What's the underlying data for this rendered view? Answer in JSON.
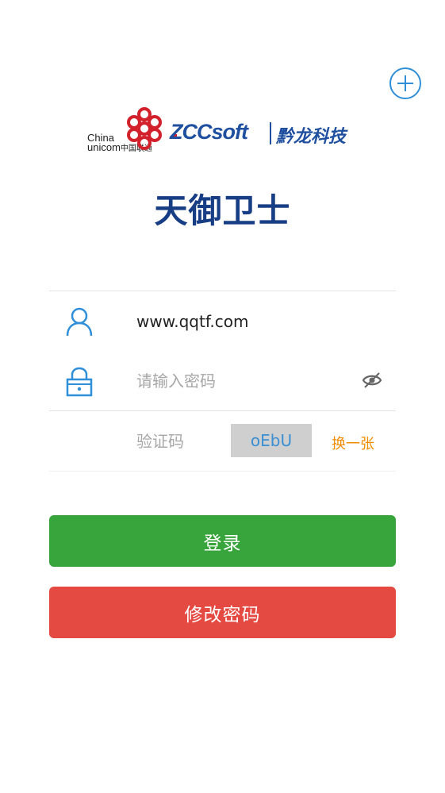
{
  "header": {
    "add_button_icon": "plus-circle-icon",
    "logo": {
      "china": "China",
      "unicom": "unicom",
      "unicom_cn": "中国联通",
      "zccsoft": "ZCCsoft",
      "partner_cn": "黔龙科技"
    },
    "app_title": "天御卫士"
  },
  "form": {
    "username": {
      "icon": "user-icon",
      "value": "www.qqtf.com"
    },
    "password": {
      "icon": "lock-icon",
      "placeholder": "请输入密码",
      "toggle_icon": "eye-off-icon"
    },
    "captcha": {
      "placeholder": "验证码",
      "code": "oEbU",
      "refresh_label": "换一张"
    }
  },
  "actions": {
    "login_label": "登录",
    "change_password_label": "修改密码"
  },
  "colors": {
    "accent_blue": "#2f8fd8",
    "title_navy": "#173e84",
    "login_green": "#38a53c",
    "change_red": "#e44a42",
    "refresh_orange": "#f08c00"
  }
}
